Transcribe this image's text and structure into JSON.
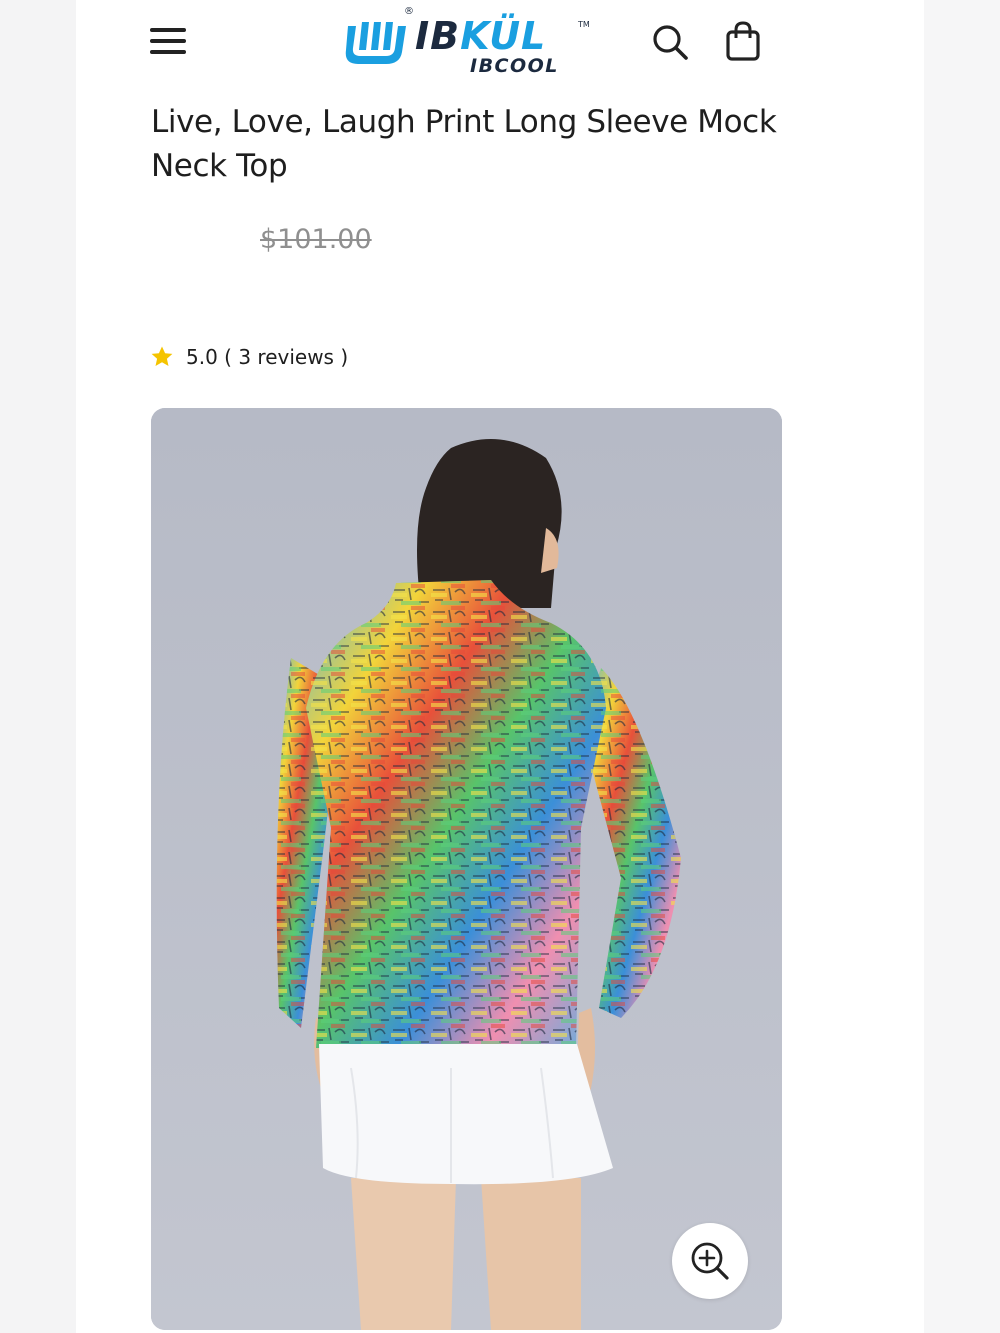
{
  "header": {
    "logo": {
      "brand_part1": "IB",
      "brand_part2": "KÜL",
      "sub": "IBCOOL",
      "registered": "®",
      "trademark": "TM"
    },
    "menu_icon": "hamburger-menu-icon",
    "search_icon": "search-icon",
    "cart_icon": "shopping-bag-icon"
  },
  "product": {
    "title": "Live, Love, Laugh Print Long Sleeve Mock Neck Top",
    "original_price": "$101.00",
    "rating": {
      "icon": "star-icon",
      "text": "5.0 ( 3 reviews )",
      "color": "#f5c400"
    }
  },
  "gallery": {
    "zoom_icon": "zoom-in-icon",
    "background_color": "#b9bdc9"
  }
}
